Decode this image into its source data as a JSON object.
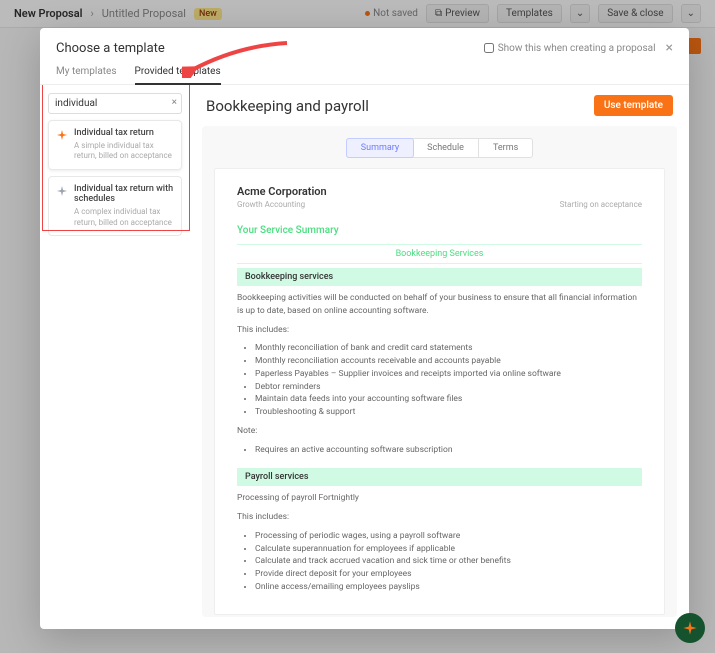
{
  "topbar": {
    "crumb1": "New Proposal",
    "crumb2": "Untitled Proposal",
    "badge": "New",
    "status": "Not saved",
    "preview": "Preview",
    "templates": "Templates",
    "save": "Save & close"
  },
  "modal": {
    "title": "Choose a template",
    "checkbox": "Show this when creating a proposal",
    "tabs": {
      "my": "My templates",
      "provided": "Provided templates"
    }
  },
  "search": {
    "value": "individual"
  },
  "cards": [
    {
      "title": "Individual tax return",
      "desc": "A simple individual tax return, billed on acceptance"
    },
    {
      "title": "Individual tax return with schedules",
      "desc": "A complex individual tax return, billed on acceptance"
    }
  ],
  "preview": {
    "title": "Bookkeeping and payroll",
    "use": "Use template",
    "segments": {
      "summary": "Summary",
      "schedule": "Schedule",
      "terms": "Terms"
    }
  },
  "doc": {
    "company": "Acme Corporation",
    "subtitle": "Growth Accounting",
    "starting": "Starting on acceptance",
    "serviceSummary": "Your Service Summary",
    "bkServicesHead": "Bookkeeping Services",
    "bkBar": "Bookkeeping services",
    "bkIntro": "Bookkeeping activities will be conducted on behalf of your business to ensure that all financial information is up to date, based on online accounting software.",
    "includes": "This includes:",
    "bkItems": [
      "Monthly reconciliation of bank and credit card statements",
      "Monthly reconciliation accounts receivable and accounts payable",
      "Paperless Payables – Supplier invoices and receipts imported via online software",
      "Debtor reminders",
      "Maintain data feeds into your accounting software files",
      "Troubleshooting & support"
    ],
    "note": "Note:",
    "noteItems": [
      "Requires an active accounting software subscription"
    ],
    "prBar": "Payroll services",
    "prIntro": "Processing of payroll Fortnightly",
    "prItems": [
      "Processing of periodic wages, using a payroll software",
      "Calculate superannuation for employees if applicable",
      "Calculate and track accrued vacation and sick time or other benefits",
      "Provide direct deposit for your employees",
      "Online access/emailing employees payslips"
    ]
  }
}
